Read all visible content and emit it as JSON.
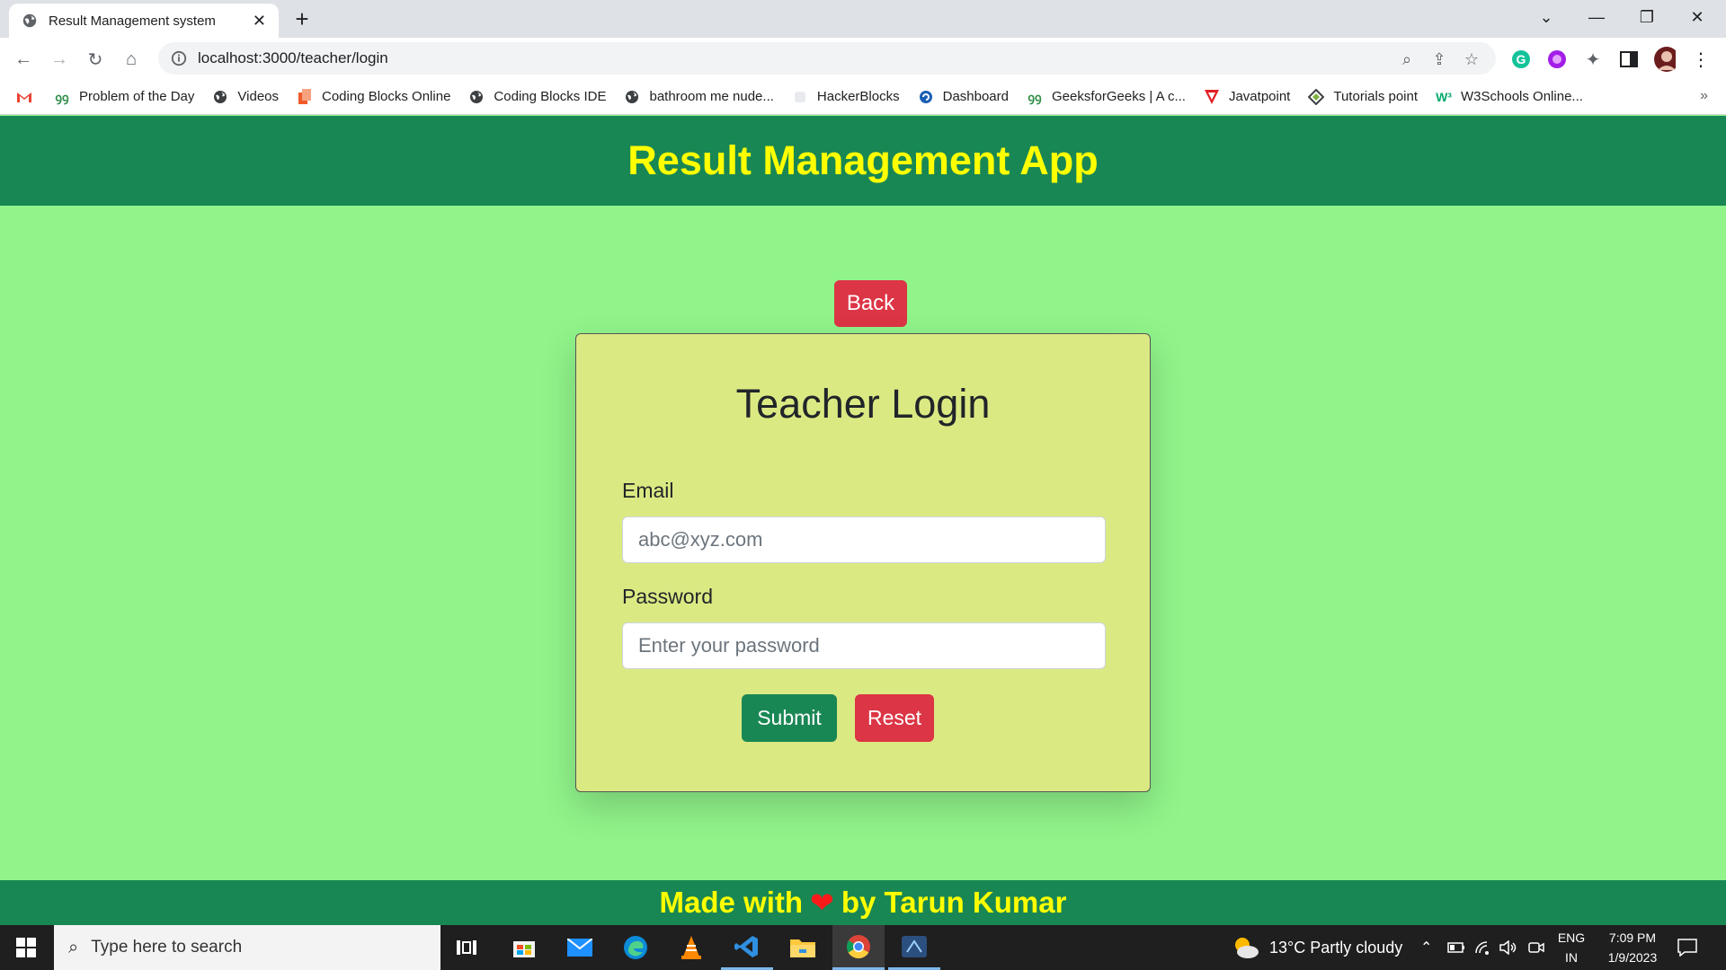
{
  "browser": {
    "tab_title": "Result Management system",
    "url": "localhost:3000/teacher/login",
    "bookmarks": [
      {
        "label": "Problem of the Day",
        "icon": "gfg-icon"
      },
      {
        "label": "Videos",
        "icon": "globe-icon"
      },
      {
        "label": "Coding Blocks Online",
        "icon": "codingblocks-icon"
      },
      {
        "label": "Coding Blocks IDE",
        "icon": "globe-icon"
      },
      {
        "label": "bathroom me nude...",
        "icon": "globe-icon"
      },
      {
        "label": "HackerBlocks",
        "icon": "hackerblocks-icon"
      },
      {
        "label": "Dashboard",
        "icon": "dashboard-icon"
      },
      {
        "label": "GeeksforGeeks | A c...",
        "icon": "gfg-icon"
      },
      {
        "label": "Javatpoint",
        "icon": "javatpoint-icon"
      },
      {
        "label": "Tutorials point",
        "icon": "tutorialspoint-icon"
      },
      {
        "label": "W3Schools Online...",
        "icon": "w3schools-icon"
      }
    ]
  },
  "app": {
    "header_title": "Result Management App",
    "back_label": "Back",
    "card": {
      "title": "Teacher Login",
      "email_label": "Email",
      "email_placeholder": "abc@xyz.com",
      "password_label": "Password",
      "password_placeholder": "Enter your password",
      "submit_label": "Submit",
      "reset_label": "Reset"
    },
    "footer": {
      "prefix": "Made with",
      "suffix": "by Tarun Kumar"
    }
  },
  "taskbar": {
    "search_placeholder": "Type here to search",
    "weather": "13°C  Partly cloudy",
    "lang_top": "ENG",
    "lang_bottom": "IN",
    "time": "7:09 PM",
    "date": "1/9/2023"
  },
  "colors": {
    "header_bg": "#198754",
    "page_bg": "#90f48a",
    "title_yellow": "#ffff00",
    "card_bg": "#dbe983",
    "danger": "#dc3545"
  }
}
